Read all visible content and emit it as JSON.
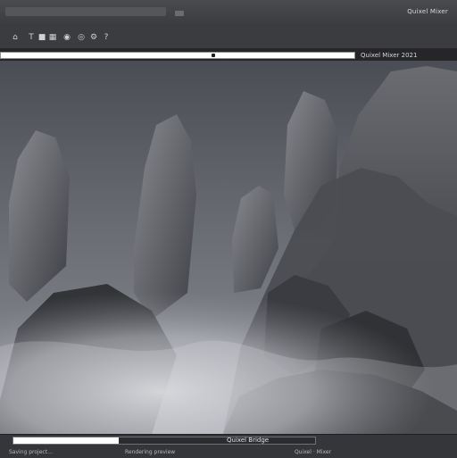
{
  "top_bar": {
    "right_label": "Quixel Mixer"
  },
  "toolbar": {
    "tools": [
      {
        "name": "home-icon",
        "glyph": "⌂"
      },
      {
        "name": "text-tool-icon",
        "glyph": "T"
      },
      {
        "name": "square-tool-icon",
        "glyph": "■"
      },
      {
        "name": "grid-tool-icon",
        "glyph": "▦"
      },
      {
        "name": "light-icon",
        "glyph": "◉"
      },
      {
        "name": "camera-icon",
        "glyph": "◎"
      },
      {
        "name": "settings-icon",
        "glyph": "⚙"
      },
      {
        "name": "help-icon",
        "glyph": "?"
      }
    ]
  },
  "viewport": {
    "top_progress": 1.0,
    "right_panel_label": "Quixel Mixer 2021",
    "scene_description_visible": false
  },
  "bottom_bar": {
    "progress": 0.35,
    "center_label": "Quixel Bridge",
    "status": {
      "left": "Saving project…",
      "middle": "Rendering preview",
      "right": "Quixel · Mixer"
    }
  },
  "colors": {
    "bar_bg": "#3b3c40",
    "viewport_bg": "#262628",
    "progress_fill": "#ffffff",
    "text": "#c9cace"
  }
}
